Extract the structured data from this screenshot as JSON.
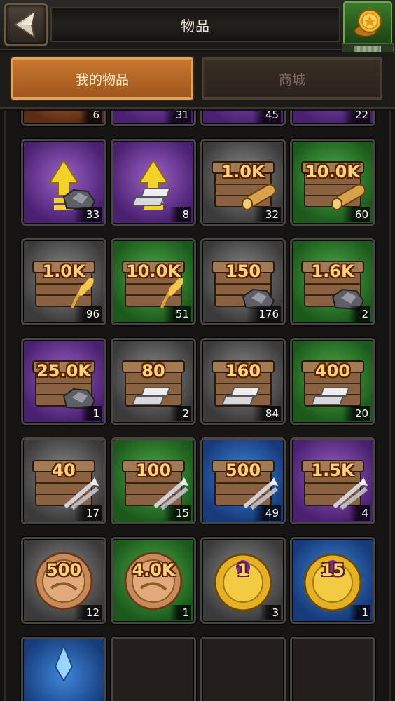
{
  "header": {
    "title": "物品",
    "back_icon": "back-arrow-icon",
    "coin_icon": "gold-coin-icon"
  },
  "tabs": [
    {
      "label": "我的物品",
      "active": true
    },
    {
      "label": "商城",
      "active": false
    }
  ],
  "items": [
    {
      "bg": "orange",
      "icon": "potion-icon",
      "badge": "",
      "qty": "6"
    },
    {
      "bg": "purple",
      "icon": "magic-hand-icon",
      "badge": "",
      "qty": "31"
    },
    {
      "bg": "purple",
      "icon": "wood-upgrade-icon",
      "badge": "",
      "qty": "45"
    },
    {
      "bg": "purple",
      "icon": "food-upgrade-icon",
      "badge": "",
      "qty": "22"
    },
    {
      "bg": "purple",
      "icon": "stone-upgrade-icon",
      "badge": "",
      "qty": "33"
    },
    {
      "bg": "purple",
      "icon": "iron-upgrade-icon",
      "badge": "",
      "qty": "8"
    },
    {
      "bg": "gray",
      "icon": "wood-chest-icon",
      "badge": "1.0K",
      "qty": "32"
    },
    {
      "bg": "green",
      "icon": "wood-chest-icon",
      "badge": "10.0K",
      "qty": "60"
    },
    {
      "bg": "gray",
      "icon": "food-chest-icon",
      "badge": "1.0K",
      "qty": "96"
    },
    {
      "bg": "green",
      "icon": "food-chest-icon",
      "badge": "10.0K",
      "qty": "51"
    },
    {
      "bg": "gray",
      "icon": "stone-chest-icon",
      "badge": "150",
      "qty": "176"
    },
    {
      "bg": "green",
      "icon": "stone-chest-icon",
      "badge": "1.6K",
      "qty": "2"
    },
    {
      "bg": "purple",
      "icon": "stone-chest-icon",
      "badge": "25.0K",
      "qty": "1"
    },
    {
      "bg": "gray",
      "icon": "iron-chest-icon",
      "badge": "80",
      "qty": "2"
    },
    {
      "bg": "gray",
      "icon": "iron-chest-icon",
      "badge": "160",
      "qty": "84"
    },
    {
      "bg": "green",
      "icon": "iron-chest-icon",
      "badge": "400",
      "qty": "20"
    },
    {
      "bg": "gray",
      "icon": "arrow-chest-icon",
      "badge": "40",
      "qty": "17"
    },
    {
      "bg": "green",
      "icon": "arrow-chest-icon",
      "badge": "100",
      "qty": "15"
    },
    {
      "bg": "blue",
      "icon": "arrow-chest-icon",
      "badge": "500",
      "qty": "49"
    },
    {
      "bg": "purple",
      "icon": "arrow-chest-icon",
      "badge": "1.5K",
      "qty": "4"
    },
    {
      "bg": "gray",
      "icon": "copper-coin-icon",
      "badge": "500",
      "qty": "12"
    },
    {
      "bg": "green",
      "icon": "copper-coin-icon",
      "badge": "4.0K",
      "qty": "1"
    },
    {
      "bg": "gray",
      "icon": "gold-medal-icon",
      "badge": "1",
      "qty": "3"
    },
    {
      "bg": "blue",
      "icon": "gold-medal-icon",
      "badge": "15",
      "qty": "1"
    },
    {
      "bg": "blue",
      "icon": "crystal-icon",
      "badge": "",
      "qty": ""
    },
    {
      "bg": "dark",
      "icon": "empty-slot-icon",
      "badge": "",
      "qty": ""
    },
    {
      "bg": "dark",
      "icon": "empty-slot-icon",
      "badge": "",
      "qty": ""
    },
    {
      "bg": "dark",
      "icon": "empty-slot-icon",
      "badge": "",
      "qty": ""
    }
  ]
}
